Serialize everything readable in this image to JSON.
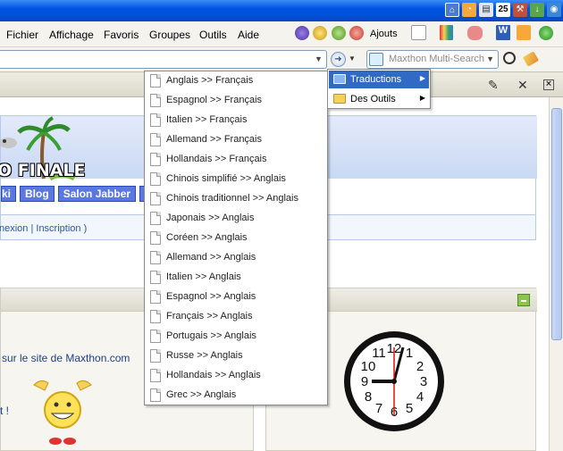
{
  "menubar": {
    "items": [
      "Fichier",
      "Affichage",
      "Favoris",
      "Groupes",
      "Outils",
      "Aide"
    ],
    "ajouts_label": "Ajouts"
  },
  "search": {
    "placeholder": "Maxthon Multi-Search"
  },
  "page": {
    "logo_text": "O FINALE",
    "nav_buttons": [
      "ki",
      "Blog",
      "Salon Jabber",
      "R"
    ],
    "login_text": "nexion | Inscription )",
    "site_text": "sur le site de Maxthon.com",
    "exclam_text": "t !"
  },
  "dropdown": {
    "items": [
      "Anglais >> Français",
      "Espagnol >> Français",
      "Italien >> Français",
      "Allemand >> Français",
      "Hollandais >> Français",
      "Chinois simplifié >> Anglais",
      "Chinois traditionnel >> Anglais",
      "Japonais >> Anglais",
      "Coréen >> Anglais",
      "Allemand >> Anglais",
      "Italien >> Anglais",
      "Espagnol >> Anglais",
      "Français >> Anglais",
      "Portugais >> Anglais",
      "Russe >> Anglais",
      "Hollandais >> Anglais",
      "Grec >> Anglais"
    ]
  },
  "submenu": {
    "items": [
      "Traductions",
      "Des Outils"
    ],
    "active_item": "Traductions"
  },
  "clock": {
    "numbers": [
      "12",
      "1",
      "2",
      "3",
      "4",
      "5",
      "6",
      "7",
      "8",
      "9",
      "10",
      "11"
    ],
    "time": "9:05"
  },
  "colors": {
    "title_blue": "#0054e3",
    "highlight": "#316ac5",
    "nav_button": "#5a78e0"
  }
}
